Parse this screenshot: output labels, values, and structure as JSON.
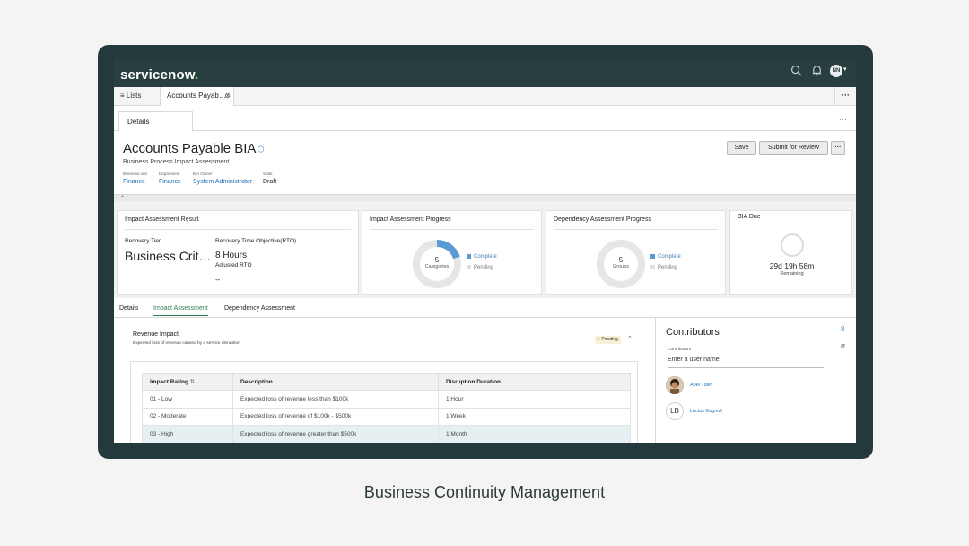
{
  "app": {
    "logo_text": "servicenow",
    "logo_dot": ".",
    "avatar_initials": "NN"
  },
  "tabs": {
    "lists_label": "Lists",
    "document_tab_label": "Accounts Payab…",
    "more": "···"
  },
  "subtabs": {
    "details_label": "Details",
    "more": "···"
  },
  "record": {
    "title": "Accounts Payable BIA",
    "subtitle": "Business Process Impact Assessment",
    "fields": [
      {
        "label": "Business unit",
        "value": "Finance"
      },
      {
        "label": "Department",
        "value": "Finance"
      },
      {
        "label": "BIA Owner",
        "value": "System Administrator"
      },
      {
        "label": "State",
        "value": "Draft"
      }
    ],
    "save_label": "Save",
    "submit_label": "Submit for Review",
    "more_label": "···"
  },
  "cards": {
    "impact_result": {
      "title": "Impact Assessment Result",
      "recovery_tier_label": "Recovery Tier",
      "recovery_tier_value": "Business Crit…",
      "rto_label": "Recovery Time Objective(RTO)",
      "rto_value": "8 Hours",
      "adjusted_rto_label": "Adjusted RTO",
      "adjusted_rto_value": "--"
    },
    "impact_progress": {
      "title": "Impact Assessment Progress",
      "count": "5",
      "unit": "Categories",
      "complete_label": "Complete",
      "pending_label": "Pending",
      "complete_fraction": 0.2
    },
    "dependency_progress": {
      "title": "Dependency Assessment Progress",
      "count": "5",
      "unit": "Groups",
      "complete_label": "Complete",
      "pending_label": "Pending",
      "complete_fraction": 0
    },
    "bia_due": {
      "title": "BIA Due",
      "value": "29d 19h 58m",
      "sub": "Remaining"
    }
  },
  "section_tabs": [
    "Details",
    "Impact Assessment",
    "Dependency Assessment"
  ],
  "revenue": {
    "title": "Revenue Impact",
    "subtitle": "Expected loss of revenue caused by a service disruption",
    "status": "Pending",
    "columns": [
      "Impact Rating",
      "Description",
      "Disruption Duration"
    ],
    "rows": [
      [
        "01 - Low",
        "Expected loss of revenue less than $100k",
        "1 Hour"
      ],
      [
        "02 - Moderate",
        "Expected loss of revenue of $100k - $500k",
        "1 Week"
      ],
      [
        "03 - High",
        "Expected loss of revenue greater than $500k",
        "1 Month"
      ]
    ]
  },
  "contributors": {
    "title": "Contributors",
    "field_label": "Contributors",
    "placeholder": "Enter a user name",
    "people": [
      {
        "name": "Abel Tuter",
        "initials": ""
      },
      {
        "name": "Lucius Bagnoli",
        "initials": "LB"
      }
    ]
  },
  "colors": {
    "accent_green": "#2e7c4f",
    "link_blue": "#1f6fb5",
    "progress_blue": "#5b9bd5",
    "progress_track": "#e6e6e6",
    "frame": "#24393b"
  },
  "caption": "Business Continuity Management"
}
